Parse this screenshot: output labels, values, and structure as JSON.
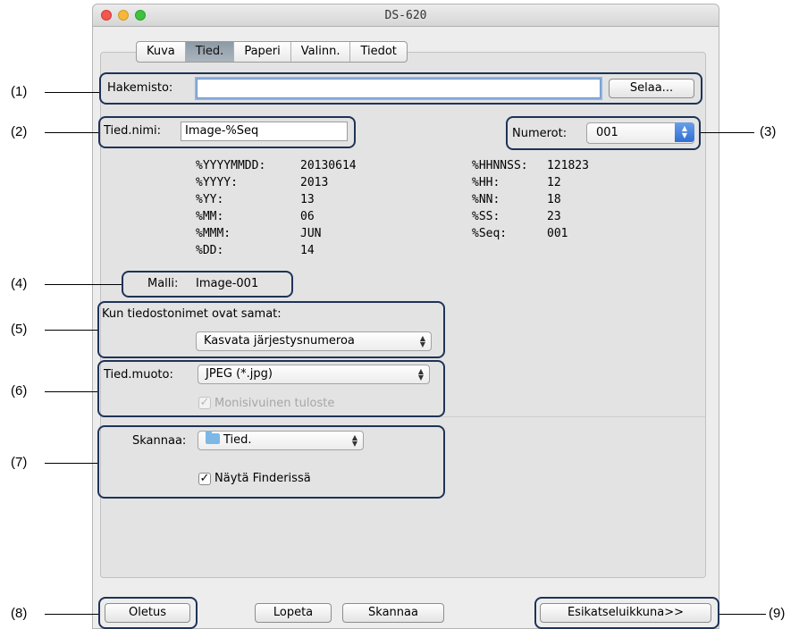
{
  "window": {
    "title": "DS-620"
  },
  "tabs": [
    "Kuva",
    "Tied.",
    "Paperi",
    "Valinn.",
    "Tiedot"
  ],
  "selected_tab": "Tied.",
  "folder": {
    "label": "Hakemisto:",
    "value": "",
    "browse_label": "Selaa..."
  },
  "filename": {
    "label": "Tied.nimi:",
    "value": "Image-%Seq"
  },
  "digits": {
    "label": "Numerot:",
    "value": "001"
  },
  "tokens_left": [
    {
      "key": "%YYYYMMDD:",
      "value": "20130614"
    },
    {
      "key": "%YYYY:",
      "value": "2013"
    },
    {
      "key": "%YY:",
      "value": "13"
    },
    {
      "key": "%MM:",
      "value": "06"
    },
    {
      "key": "%MMM:",
      "value": "JUN"
    },
    {
      "key": "%DD:",
      "value": "14"
    }
  ],
  "tokens_right": [
    {
      "key": "%HHNNSS:",
      "value": "121823"
    },
    {
      "key": "%HH:",
      "value": "12"
    },
    {
      "key": "%NN:",
      "value": "18"
    },
    {
      "key": "%SS:",
      "value": "23"
    },
    {
      "key": "%Seq:",
      "value": "001"
    }
  ],
  "sample": {
    "label": "Malli:",
    "value": "Image-001"
  },
  "duplicate": {
    "label": "Kun tiedostonimet ovat samat:",
    "value": "Kasvata järjestysnumeroa"
  },
  "format": {
    "label": "Tied.muoto:",
    "value": "JPEG (*.jpg)",
    "multipage_label": "Monisivuinen tuloste",
    "multipage_checked": true,
    "multipage_enabled": false
  },
  "scan_to": {
    "label": "Skannaa:",
    "value": "Tied.",
    "icon": "folder-icon"
  },
  "show_in_finder": {
    "label": "Näytä Finderissä",
    "checked": true
  },
  "buttons": {
    "default": "Oletus",
    "quit": "Lopeta",
    "scan": "Skannaa",
    "preview": "Esikatseluikkuna>>"
  },
  "callouts": [
    "(1)",
    "(2)",
    "(3)",
    "(4)",
    "(5)",
    "(6)",
    "(7)",
    "(8)",
    "(9)"
  ],
  "colors": {
    "highlight": "#1f3357",
    "selected_tab": "#9aa6b0",
    "stepper": "#3a78d8"
  }
}
